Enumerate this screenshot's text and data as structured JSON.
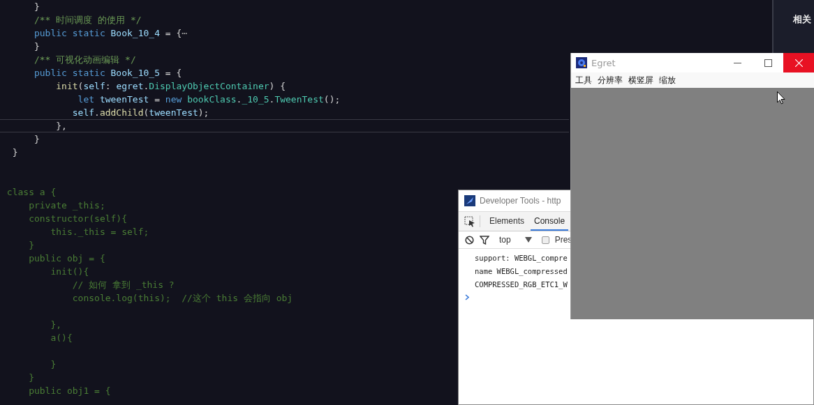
{
  "editor": {
    "lines": [
      {
        "current": false,
        "tokens": [
          {
            "kind": "punct",
            "text": "      }"
          }
        ]
      },
      {
        "current": false,
        "tokens": [
          {
            "kind": "comment",
            "text": "      /** 时间调度 的使用 */"
          }
        ]
      },
      {
        "current": false,
        "tokens": [
          {
            "kind": "keyword",
            "text": "      public static "
          },
          {
            "kind": "ident",
            "text": "Book_10_4"
          },
          {
            "kind": "punct",
            "text": " = {"
          },
          {
            "kind": "fold",
            "text": "⋯"
          }
        ]
      },
      {
        "current": false,
        "tokens": [
          {
            "kind": "punct",
            "text": "      }"
          }
        ]
      },
      {
        "current": false,
        "tokens": [
          {
            "kind": "comment",
            "text": "      /** 可视化动画编辑 */"
          }
        ]
      },
      {
        "current": false,
        "tokens": [
          {
            "kind": "keyword",
            "text": "      public static "
          },
          {
            "kind": "ident",
            "text": "Book_10_5"
          },
          {
            "kind": "punct",
            "text": " = {"
          }
        ]
      },
      {
        "current": false,
        "tokens": [
          {
            "kind": "func",
            "text": "          init"
          },
          {
            "kind": "punct",
            "text": "("
          },
          {
            "kind": "ident",
            "text": "self"
          },
          {
            "kind": "punct",
            "text": ": "
          },
          {
            "kind": "ident",
            "text": "egret"
          },
          {
            "kind": "punct",
            "text": "."
          },
          {
            "kind": "class",
            "text": "DisplayObjectContainer"
          },
          {
            "kind": "punct",
            "text": ") {"
          }
        ]
      },
      {
        "current": false,
        "tokens": [
          {
            "kind": "keyword",
            "text": "              let "
          },
          {
            "kind": "ident",
            "text": "tweenTest"
          },
          {
            "kind": "punct",
            "text": " = "
          },
          {
            "kind": "keyword",
            "text": "new "
          },
          {
            "kind": "class",
            "text": "bookClass"
          },
          {
            "kind": "punct",
            "text": "."
          },
          {
            "kind": "class",
            "text": "_10_5"
          },
          {
            "kind": "punct",
            "text": "."
          },
          {
            "kind": "class",
            "text": "TweenTest"
          },
          {
            "kind": "punct",
            "text": "();"
          }
        ]
      },
      {
        "current": false,
        "tokens": [
          {
            "kind": "ident",
            "text": "             self"
          },
          {
            "kind": "punct",
            "text": "."
          },
          {
            "kind": "func",
            "text": "addChild"
          },
          {
            "kind": "punct",
            "text": "("
          },
          {
            "kind": "ident",
            "text": "tweenTest"
          },
          {
            "kind": "punct",
            "text": ");"
          }
        ]
      },
      {
        "current": true,
        "tokens": [
          {
            "kind": "punct",
            "text": "          },"
          }
        ]
      },
      {
        "current": false,
        "tokens": [
          {
            "kind": "punct",
            "text": "      }"
          }
        ]
      },
      {
        "current": false,
        "tokens": [
          {
            "kind": "punct",
            "text": "  }"
          }
        ]
      },
      {
        "current": false
      },
      {
        "current": false
      },
      {
        "current": false,
        "tokens": [
          {
            "kind": "disabled",
            "text": " class a {"
          }
        ]
      },
      {
        "current": false,
        "tokens": [
          {
            "kind": "disabled",
            "text": "     private _this;"
          }
        ]
      },
      {
        "current": false,
        "tokens": [
          {
            "kind": "disabled",
            "text": "     constructor(self){"
          }
        ]
      },
      {
        "current": false,
        "tokens": [
          {
            "kind": "disabled",
            "text": "         this._this = self;"
          }
        ]
      },
      {
        "current": false,
        "tokens": [
          {
            "kind": "disabled",
            "text": "     }"
          }
        ]
      },
      {
        "current": false,
        "tokens": [
          {
            "kind": "disabled",
            "text": "     public obj = {"
          }
        ]
      },
      {
        "current": false,
        "tokens": [
          {
            "kind": "disabled",
            "text": "         init(){"
          }
        ]
      },
      {
        "current": false,
        "tokens": [
          {
            "kind": "disabled",
            "text": "             // 如何 拿到 _this ?"
          }
        ]
      },
      {
        "current": false,
        "tokens": [
          {
            "kind": "disabled",
            "text": "             console.log(this);  //这个 this 会指向 obj"
          }
        ]
      },
      {
        "current": false
      },
      {
        "current": false,
        "tokens": [
          {
            "kind": "disabled",
            "text": "         },"
          }
        ]
      },
      {
        "current": false,
        "tokens": [
          {
            "kind": "disabled",
            "text": "         a(){"
          }
        ]
      },
      {
        "current": false
      },
      {
        "current": false,
        "tokens": [
          {
            "kind": "disabled",
            "text": "         }"
          }
        ]
      },
      {
        "current": false,
        "tokens": [
          {
            "kind": "disabled",
            "text": "     }"
          }
        ]
      },
      {
        "current": false,
        "tokens": [
          {
            "kind": "disabled",
            "text": "     public obj1 = {"
          }
        ]
      }
    ]
  },
  "sidebar": {
    "heading": "相关"
  },
  "devtools": {
    "title": "Developer Tools - http",
    "tabs": [
      {
        "label": "Elements",
        "selected": false
      },
      {
        "label": "Console",
        "selected": true
      }
    ],
    "context": "top",
    "preserve": {
      "label": "Pres",
      "checked": false
    },
    "console_lines": [
      "support: WEBGL_compre",
      "name WEBGL_compressed",
      "COMPRESSED_RGB_ETC1_W"
    ]
  },
  "egret": {
    "title": "Egret",
    "menu": [
      "工具",
      "分辨率",
      "横竖屏",
      "缩放"
    ]
  }
}
